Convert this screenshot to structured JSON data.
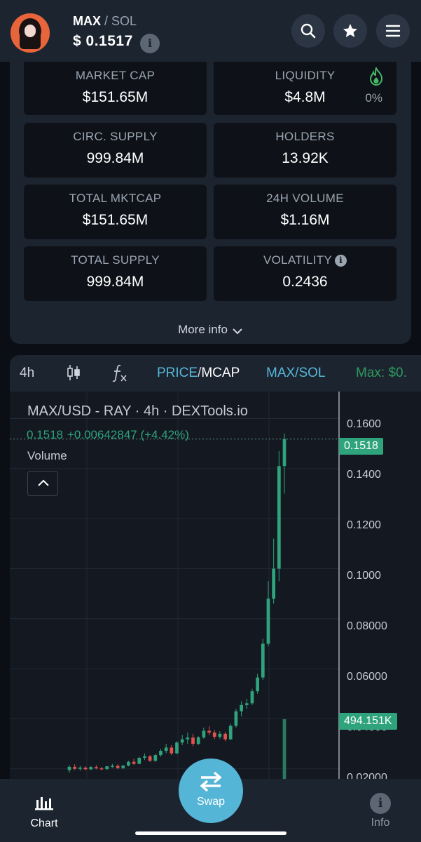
{
  "header": {
    "base_symbol": "MAX",
    "separator": "/",
    "quote_symbol": "SOL",
    "price": "$  0.1517",
    "icons": [
      "search-icon",
      "star-icon",
      "menu-icon"
    ]
  },
  "stats": {
    "market_cap": {
      "label": "MARKET CAP",
      "value": "$151.65M"
    },
    "liquidity": {
      "label": "LIQUIDITY",
      "value": "$4.8M",
      "percent": "0%"
    },
    "circ_supply": {
      "label": "CIRC. SUPPLY",
      "value": "999.84M"
    },
    "holders": {
      "label": "HOLDERS",
      "value": "13.92K"
    },
    "total_mktcap": {
      "label": "TOTAL MKTCAP",
      "value": "$151.65M"
    },
    "volume_24h": {
      "label": "24H VOLUME",
      "value": "$1.16M"
    },
    "total_supply": {
      "label": "TOTAL SUPPLY",
      "value": "999.84M"
    },
    "volatility": {
      "label": "VOLATILITY",
      "value": "0.2436"
    },
    "more_info": "More info"
  },
  "toolbar": {
    "interval": "4h",
    "price_label": "PRICE",
    "slash": "/",
    "mcap_label": "MCAP",
    "pair_label": "MAX/SOL",
    "max_label": "Max: $0."
  },
  "chart": {
    "title": "MAX/USD - RAY · 4h · DEXTools.io",
    "ohlc_price": "0.1518",
    "ohlc_change": "+0.00642847 (+4.42%)",
    "volume_label": "Volume",
    "price_badge": "0.1518",
    "volume_badge": "494.151K",
    "y_ticks": [
      "0.1600",
      "0.1400",
      "0.1200",
      "0.1000",
      "0.08000",
      "0.06000",
      "0.04000",
      "0.02000"
    ],
    "colors": {
      "up": "#2fa37b",
      "down": "#e0524d",
      "panel": "#131821"
    }
  },
  "chart_data": {
    "type": "candlestick",
    "title": "MAX/USD - RAY · 4h · DEXTools.io",
    "ylim": [
      0.016,
      0.1708
    ],
    "y_ticks": [
      0.16,
      0.14,
      0.12,
      0.1,
      0.08,
      0.06,
      0.04,
      0.02
    ],
    "last_price": 0.1518,
    "last_volume": "494.151K",
    "candles": [
      {
        "o": 0.0195,
        "h": 0.0215,
        "l": 0.0185,
        "c": 0.0208
      },
      {
        "o": 0.0208,
        "h": 0.0218,
        "l": 0.0195,
        "c": 0.02
      },
      {
        "o": 0.02,
        "h": 0.0212,
        "l": 0.0192,
        "c": 0.0205
      },
      {
        "o": 0.0205,
        "h": 0.021,
        "l": 0.0195,
        "c": 0.0198
      },
      {
        "o": 0.0198,
        "h": 0.0212,
        "l": 0.0195,
        "c": 0.0207
      },
      {
        "o": 0.0207,
        "h": 0.0215,
        "l": 0.0198,
        "c": 0.0202
      },
      {
        "o": 0.0202,
        "h": 0.0208,
        "l": 0.0195,
        "c": 0.0199
      },
      {
        "o": 0.0199,
        "h": 0.0212,
        "l": 0.0196,
        "c": 0.021
      },
      {
        "o": 0.021,
        "h": 0.022,
        "l": 0.0204,
        "c": 0.0212
      },
      {
        "o": 0.0212,
        "h": 0.0218,
        "l": 0.02,
        "c": 0.0203
      },
      {
        "o": 0.0203,
        "h": 0.0215,
        "l": 0.0199,
        "c": 0.0213
      },
      {
        "o": 0.0213,
        "h": 0.0232,
        "l": 0.021,
        "c": 0.0228
      },
      {
        "o": 0.0228,
        "h": 0.024,
        "l": 0.0215,
        "c": 0.022
      },
      {
        "o": 0.022,
        "h": 0.0248,
        "l": 0.0218,
        "c": 0.0244
      },
      {
        "o": 0.0244,
        "h": 0.0262,
        "l": 0.0235,
        "c": 0.025
      },
      {
        "o": 0.025,
        "h": 0.0255,
        "l": 0.0228,
        "c": 0.0232
      },
      {
        "o": 0.0232,
        "h": 0.026,
        "l": 0.0228,
        "c": 0.0255
      },
      {
        "o": 0.0255,
        "h": 0.028,
        "l": 0.0248,
        "c": 0.0272
      },
      {
        "o": 0.0272,
        "h": 0.03,
        "l": 0.0262,
        "c": 0.0285
      },
      {
        "o": 0.0285,
        "h": 0.0295,
        "l": 0.0255,
        "c": 0.0262
      },
      {
        "o": 0.0262,
        "h": 0.031,
        "l": 0.0258,
        "c": 0.0305
      },
      {
        "o": 0.0305,
        "h": 0.0335,
        "l": 0.0295,
        "c": 0.0318
      },
      {
        "o": 0.0318,
        "h": 0.0345,
        "l": 0.03,
        "c": 0.0325
      },
      {
        "o": 0.0325,
        "h": 0.034,
        "l": 0.029,
        "c": 0.03
      },
      {
        "o": 0.03,
        "h": 0.033,
        "l": 0.0295,
        "c": 0.0326
      },
      {
        "o": 0.0326,
        "h": 0.0365,
        "l": 0.032,
        "c": 0.0352
      },
      {
        "o": 0.0352,
        "h": 0.037,
        "l": 0.0335,
        "c": 0.0345
      },
      {
        "o": 0.0345,
        "h": 0.0355,
        "l": 0.0318,
        "c": 0.0328
      },
      {
        "o": 0.0328,
        "h": 0.035,
        "l": 0.032,
        "c": 0.034
      },
      {
        "o": 0.034,
        "h": 0.0348,
        "l": 0.031,
        "c": 0.0318
      },
      {
        "o": 0.0318,
        "h": 0.038,
        "l": 0.0315,
        "c": 0.0372
      },
      {
        "o": 0.0372,
        "h": 0.044,
        "l": 0.0365,
        "c": 0.043
      },
      {
        "o": 0.043,
        "h": 0.047,
        "l": 0.041,
        "c": 0.0455
      },
      {
        "o": 0.0455,
        "h": 0.048,
        "l": 0.044,
        "c": 0.0462
      },
      {
        "o": 0.0462,
        "h": 0.052,
        "l": 0.0455,
        "c": 0.051
      },
      {
        "o": 0.051,
        "h": 0.058,
        "l": 0.05,
        "c": 0.0565
      },
      {
        "o": 0.0565,
        "h": 0.072,
        "l": 0.0555,
        "c": 0.07
      },
      {
        "o": 0.07,
        "h": 0.095,
        "l": 0.069,
        "c": 0.088
      },
      {
        "o": 0.088,
        "h": 0.112,
        "l": 0.086,
        "c": 0.1
      },
      {
        "o": 0.1,
        "h": 0.147,
        "l": 0.095,
        "c": 0.141
      },
      {
        "o": 0.141,
        "h": 0.154,
        "l": 0.13,
        "c": 0.1518
      }
    ]
  }
}
